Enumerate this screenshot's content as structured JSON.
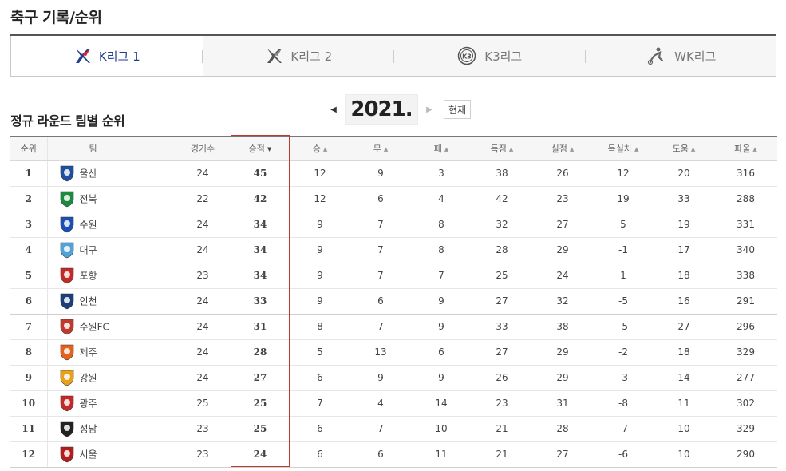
{
  "page_title": "축구 기록/순위",
  "tabs": [
    {
      "label": "K리그 1",
      "icon": "kleague1-logo",
      "active": true
    },
    {
      "label": "K리그 2",
      "icon": "kleague2-logo",
      "active": false
    },
    {
      "label": "K3리그",
      "icon": "k3league-logo",
      "active": false
    },
    {
      "label": "WK리그",
      "icon": "wkleague-logo",
      "active": false
    }
  ],
  "section_title": "정규 라운드 팀별 순위",
  "year_nav": {
    "year": "2021.",
    "now_label": "현재",
    "prev_icon": "caret-left-icon",
    "next_icon": "caret-right-icon"
  },
  "columns": {
    "rank": "순위",
    "team": "팀",
    "played": "경기수",
    "points": "승점",
    "wins": "승",
    "draws": "무",
    "losses": "패",
    "gf": "득점",
    "ga": "실점",
    "gd": "득실차",
    "assists": "도움",
    "fouls": "파울"
  },
  "rows": [
    {
      "rank": "1",
      "team": "울산",
      "played": "24",
      "points": "45",
      "wins": "12",
      "draws": "9",
      "losses": "3",
      "gf": "38",
      "ga": "26",
      "gd": "12",
      "assists": "20",
      "fouls": "316",
      "color": "#1f4fa0"
    },
    {
      "rank": "2",
      "team": "전북",
      "played": "22",
      "points": "42",
      "wins": "12",
      "draws": "6",
      "losses": "4",
      "gf": "42",
      "ga": "23",
      "gd": "19",
      "assists": "33",
      "fouls": "288",
      "color": "#1e8a3e"
    },
    {
      "rank": "3",
      "team": "수원",
      "played": "24",
      "points": "34",
      "wins": "9",
      "draws": "7",
      "losses": "8",
      "gf": "32",
      "ga": "27",
      "gd": "5",
      "assists": "19",
      "fouls": "331",
      "color": "#1a4fb8"
    },
    {
      "rank": "4",
      "team": "대구",
      "played": "24",
      "points": "34",
      "wins": "9",
      "draws": "7",
      "losses": "8",
      "gf": "28",
      "ga": "29",
      "gd": "-1",
      "assists": "17",
      "fouls": "340",
      "color": "#4fa3d9"
    },
    {
      "rank": "5",
      "team": "포항",
      "played": "23",
      "points": "34",
      "wins": "9",
      "draws": "7",
      "losses": "7",
      "gf": "25",
      "ga": "24",
      "gd": "1",
      "assists": "18",
      "fouls": "338",
      "color": "#c62828"
    },
    {
      "rank": "6",
      "team": "인천",
      "played": "24",
      "points": "33",
      "wins": "9",
      "draws": "6",
      "losses": "9",
      "gf": "27",
      "ga": "32",
      "gd": "-5",
      "assists": "16",
      "fouls": "291",
      "color": "#1a3f7a"
    },
    {
      "rank": "7",
      "team": "수원FC",
      "played": "24",
      "points": "31",
      "wins": "8",
      "draws": "7",
      "losses": "9",
      "gf": "33",
      "ga": "38",
      "gd": "-5",
      "assists": "27",
      "fouls": "296",
      "color": "#c0392b"
    },
    {
      "rank": "8",
      "team": "제주",
      "played": "24",
      "points": "28",
      "wins": "5",
      "draws": "13",
      "losses": "6",
      "gf": "27",
      "ga": "29",
      "gd": "-2",
      "assists": "18",
      "fouls": "329",
      "color": "#e8611a"
    },
    {
      "rank": "9",
      "team": "강원",
      "played": "24",
      "points": "27",
      "wins": "6",
      "draws": "9",
      "losses": "9",
      "gf": "26",
      "ga": "29",
      "gd": "-3",
      "assists": "14",
      "fouls": "277",
      "color": "#e9a11b"
    },
    {
      "rank": "10",
      "team": "광주",
      "played": "25",
      "points": "25",
      "wins": "7",
      "draws": "4",
      "losses": "14",
      "gf": "23",
      "ga": "31",
      "gd": "-8",
      "assists": "11",
      "fouls": "302",
      "color": "#c62828"
    },
    {
      "rank": "11",
      "team": "성남",
      "played": "23",
      "points": "25",
      "wins": "6",
      "draws": "7",
      "losses": "10",
      "gf": "21",
      "ga": "28",
      "gd": "-7",
      "assists": "10",
      "fouls": "329",
      "color": "#222222"
    },
    {
      "rank": "12",
      "team": "서울",
      "played": "23",
      "points": "24",
      "wins": "6",
      "draws": "6",
      "losses": "11",
      "gf": "21",
      "ga": "27",
      "gd": "-6",
      "assists": "10",
      "fouls": "290",
      "color": "#b71c1c"
    }
  ]
}
